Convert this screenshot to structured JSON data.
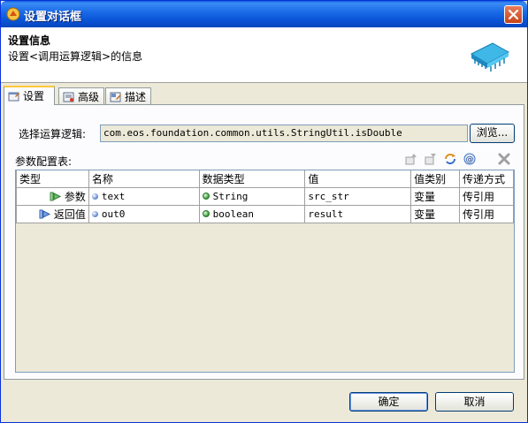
{
  "window": {
    "title": "设置对话框",
    "close_label": "×"
  },
  "header": {
    "title": "设置信息",
    "description": "设置<调用运算逻辑>的信息"
  },
  "tabs": [
    {
      "label": "设置",
      "icon": "settings-tab-icon",
      "active": true
    },
    {
      "label": "高级",
      "icon": "advanced-tab-icon",
      "active": false
    },
    {
      "label": "描述",
      "icon": "description-tab-icon",
      "active": false
    }
  ],
  "logic": {
    "label": "选择运算逻辑:",
    "value": "com.eos.foundation.common.utils.StringUtil.isDouble",
    "browse_label": "浏览..."
  },
  "params": {
    "label": "参数配置表:",
    "toolbar_icons": [
      "move-up-icon",
      "move-down-icon",
      "refresh-icon",
      "at-icon",
      "delete-icon"
    ],
    "columns": [
      "类型",
      "名称",
      "数据类型",
      "值",
      "值类别",
      "传递方式"
    ],
    "rows": [
      {
        "kind": "参数",
        "kind_icon": "arrow-in-icon",
        "name": "text",
        "data_type": "String",
        "value": "src_str",
        "value_category": "变量",
        "pass_mode": "传引用"
      },
      {
        "kind": "返回值",
        "kind_icon": "arrow-out-icon",
        "name": "out0",
        "data_type": "boolean",
        "value": "result",
        "value_category": "变量",
        "pass_mode": "传引用"
      }
    ]
  },
  "footer": {
    "ok_label": "确定",
    "cancel_label": "取消"
  },
  "colors": {
    "titlebar": "#0a56d8",
    "dialog_bg": "#ece9d8",
    "active_tab_accent": "#ffc83c"
  }
}
